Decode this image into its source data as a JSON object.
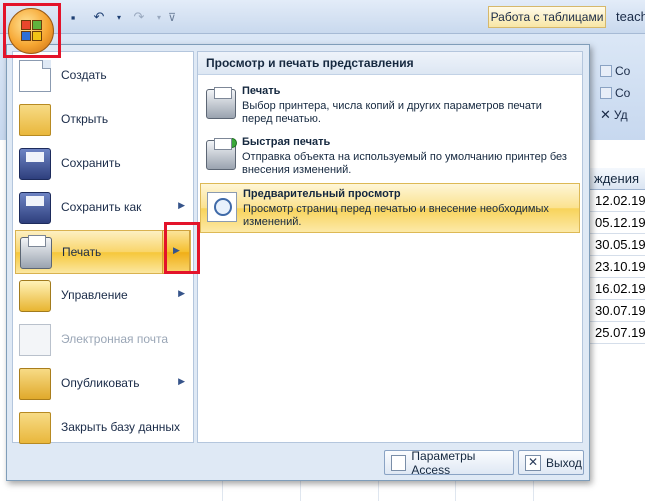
{
  "app": {
    "tools_tab": "Работа с таблицами",
    "doc_title": "teach"
  },
  "qat": {
    "save_icon": "save-icon",
    "undo_icon": "undo-icon",
    "redo_icon": "redo-icon",
    "customize_icon": "customize-qat-icon"
  },
  "ribbon": {
    "right_items": [
      "Со",
      "Со",
      "Уд"
    ]
  },
  "table": {
    "column_header": "ждения",
    "dates": [
      "12.02.19",
      "05.12.19",
      "30.05.19",
      "23.10.19",
      "16.02.19",
      "30.07.19",
      "25.07.19"
    ]
  },
  "menu": {
    "items": [
      {
        "label": "Создать",
        "icon": "new-document-icon"
      },
      {
        "label": "Открыть",
        "icon": "open-folder-icon"
      },
      {
        "label": "Сохранить",
        "icon": "save-icon"
      },
      {
        "label": "Сохранить как",
        "icon": "save-as-icon",
        "has_submenu": true
      },
      {
        "label": "Печать",
        "icon": "printer-icon",
        "has_submenu": true,
        "active": true
      },
      {
        "label": "Управление",
        "icon": "manage-icon",
        "has_submenu": true
      },
      {
        "label": "Электронная почта",
        "icon": "email-icon",
        "disabled": true
      },
      {
        "label": "Опубликовать",
        "icon": "publish-icon",
        "has_submenu": true
      },
      {
        "label": "Закрыть базу данных",
        "icon": "close-database-icon"
      }
    ],
    "submenu": {
      "header": "Просмотр и печать представления",
      "items": [
        {
          "title": "Печать",
          "description": "Выбор принтера, числа копий и других параметров печати перед печатью.",
          "icon": "printer-icon"
        },
        {
          "title": "Быстрая печать",
          "description": "Отправка объекта на используемый по умолчанию принтер без внесения изменений.",
          "icon": "quick-print-icon"
        },
        {
          "title": "Предварительный просмотр",
          "description": "Просмотр страниц перед печатью и внесение необходимых изменений.",
          "icon": "print-preview-icon",
          "active": true
        }
      ]
    },
    "access_options": "Параметры Access",
    "exit": "Выход"
  }
}
